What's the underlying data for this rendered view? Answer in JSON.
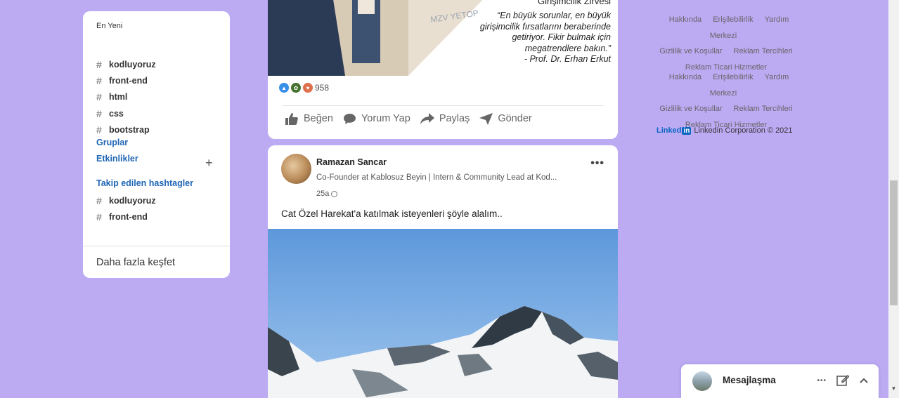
{
  "left_sidebar": {
    "newest_label": "En Yeni",
    "hashtags": [
      "kodluyoruz",
      "front-end",
      "html",
      "css",
      "bootstrap"
    ],
    "groups_label": "Gruplar",
    "events_label": "Etkinlikler",
    "followed_label": "Takip edilen hashtagler",
    "followed_hashtags": [
      "kodluyoruz",
      "front-end"
    ],
    "discover_label": "Daha fazla keşfet",
    "hash_symbol": "#",
    "plus_symbol": "+"
  },
  "post1": {
    "summit_text": "Girişimcilik Zirvesi",
    "banner_text": "MZV YETOP",
    "quote_lines": [
      "“En büyük sorunlar, en büyük",
      "girişimcilik fırsatlarını beraberinde",
      "getiriyor. Fikir bulmak için",
      "megatrendlere bakın.”"
    ],
    "quote_author": "- Prof. Dr. Erhan Erkut",
    "reaction_count": "958",
    "actions": {
      "like": "Beğen",
      "comment": "Yorum Yap",
      "share": "Paylaş",
      "send": "Gönder"
    }
  },
  "post2": {
    "author": "Ramazan Sancar",
    "subtitle": "Co-Founder at Kablosuz Beyin | Intern & Community Lead at Kod...",
    "time": "25a",
    "text": "Cat Özel Harekat'a katılmak isteyenleri şöyle alalım..",
    "more": "•••"
  },
  "footer": {
    "group1": {
      "row1": [
        "Hakkında",
        "Erişilebilirlik",
        "Yardım Merkezi"
      ],
      "row2": [
        "Gizlilik ve Koşullar",
        "Reklam Tercihleri"
      ],
      "row3": [
        "Reklam Ticari Hizmetler"
      ]
    },
    "group2": {
      "row1": [
        "Hakkında",
        "Erişilebilirlik",
        "Yardım Merkezi"
      ],
      "row2": [
        "Gizlilik ve Koşullar",
        "Reklam Tercihleri"
      ],
      "row3": [
        "Reklam Ticari Hizmetler"
      ]
    },
    "logo_text": "Linked",
    "logo_box": "in",
    "copyright": "Linkedin Corporation © 2021"
  },
  "messaging": {
    "title": "Mesajlaşma",
    "more": "•••",
    "compose_icon": "compose-icon",
    "collapse_icon": "chevron-up-icon"
  },
  "colors": {
    "background": "#bcaaf3",
    "link_blue": "#1f66b5",
    "linkedin_blue": "#0a66c2"
  }
}
